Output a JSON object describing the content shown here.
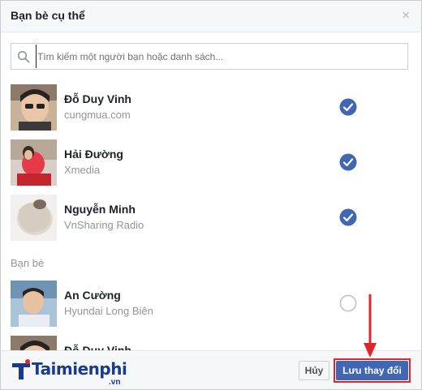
{
  "dialog": {
    "title": "Bạn bè cụ thể",
    "close_label": "×"
  },
  "search": {
    "placeholder": "Tìm kiếm một người bạn hoặc danh sách..."
  },
  "selected": [
    {
      "name": "Đỗ Duy Vinh",
      "sub": "cungmua.com",
      "checked": true
    },
    {
      "name": "Hải Đường",
      "sub": "Xmedia",
      "checked": true
    },
    {
      "name": "Nguyễn Minh",
      "sub": "VnSharing Radio",
      "checked": true
    }
  ],
  "friends_section": {
    "label": "Bạn bè",
    "items": [
      {
        "name": "An Cường",
        "sub": "Hyundai Long Biên",
        "checked": false
      },
      {
        "name": "Đỗ Duy Vinh",
        "sub": "",
        "checked": false
      }
    ]
  },
  "footer": {
    "cancel_label": "Hủy",
    "save_label": "Lưu thay đổi"
  },
  "watermark": {
    "logo_text": "Taimienphi",
    "logo_suffix": ".vn"
  },
  "colors": {
    "accent": "#4267b2",
    "highlight": "#e0262c"
  }
}
